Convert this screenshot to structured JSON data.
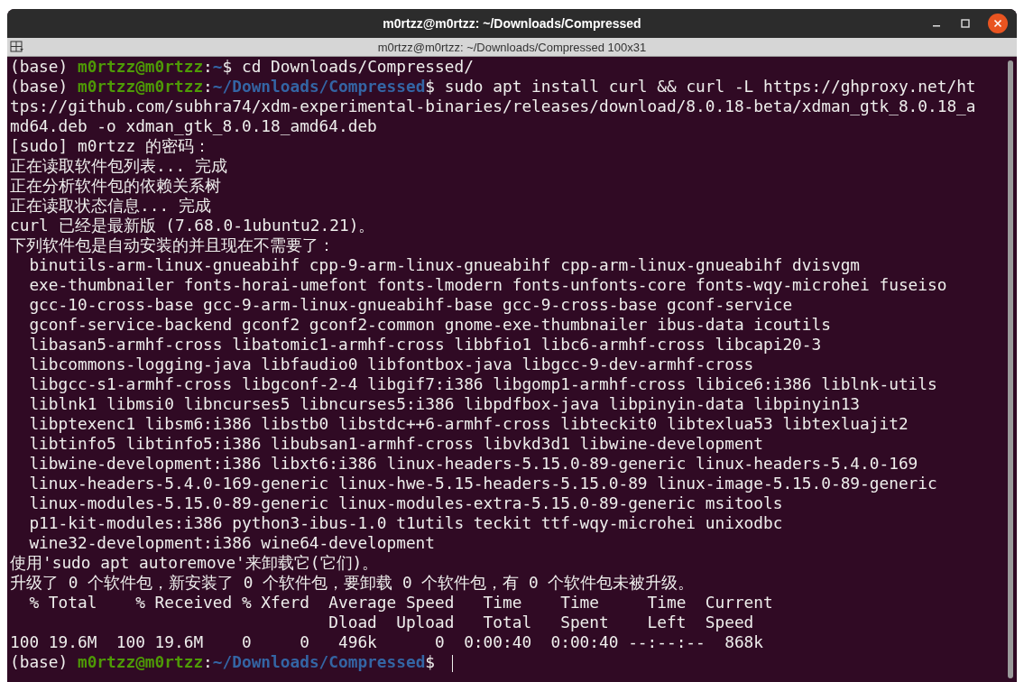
{
  "window": {
    "title": "m0rtzz@m0rtzz: ~/Downloads/Compressed"
  },
  "tab_bar": {
    "title": "m0rtzz@m0rtzz: ~/Downloads/Compressed 100x31"
  },
  "lines": [
    {
      "kind": "prompt",
      "segments": [
        {
          "kind": "plain",
          "text": "(base) "
        },
        {
          "kind": "user",
          "text": "m0rtzz@m0rtzz"
        },
        {
          "kind": "plain",
          "text": ":"
        },
        {
          "kind": "path",
          "text": "~"
        },
        {
          "kind": "plain",
          "text": "$ cd Downloads/Compressed/"
        }
      ]
    },
    {
      "kind": "prompt",
      "segments": [
        {
          "kind": "plain",
          "text": "(base) "
        },
        {
          "kind": "user",
          "text": "m0rtzz@m0rtzz"
        },
        {
          "kind": "plain",
          "text": ":"
        },
        {
          "kind": "path",
          "text": "~/Downloads/Compressed"
        },
        {
          "kind": "plain",
          "text": "$ sudo apt install curl && curl -L https://ghproxy.net/ht"
        }
      ]
    },
    {
      "kind": "text",
      "text": "tps://github.com/subhra74/xdm-experimental-binaries/releases/download/8.0.18-beta/xdman_gtk_8.0.18_a"
    },
    {
      "kind": "text",
      "text": "md64.deb -o xdman_gtk_8.0.18_amd64.deb"
    },
    {
      "kind": "text",
      "text": "[sudo] m0rtzz 的密码："
    },
    {
      "kind": "text",
      "text": "正在读取软件包列表... 完成"
    },
    {
      "kind": "text",
      "text": "正在分析软件包的依赖关系树"
    },
    {
      "kind": "text",
      "text": "正在读取状态信息... 完成"
    },
    {
      "kind": "text",
      "text": "curl 已经是最新版 (7.68.0-1ubuntu2.21)。"
    },
    {
      "kind": "text",
      "text": "下列软件包是自动安装的并且现在不需要了："
    },
    {
      "kind": "text",
      "text": "  binutils-arm-linux-gnueabihf cpp-9-arm-linux-gnueabihf cpp-arm-linux-gnueabihf dvisvgm"
    },
    {
      "kind": "text",
      "text": "  exe-thumbnailer fonts-horai-umefont fonts-lmodern fonts-unfonts-core fonts-wqy-microhei fuseiso"
    },
    {
      "kind": "text",
      "text": "  gcc-10-cross-base gcc-9-arm-linux-gnueabihf-base gcc-9-cross-base gconf-service"
    },
    {
      "kind": "text",
      "text": "  gconf-service-backend gconf2 gconf2-common gnome-exe-thumbnailer ibus-data icoutils"
    },
    {
      "kind": "text",
      "text": "  libasan5-armhf-cross libatomic1-armhf-cross libbfio1 libc6-armhf-cross libcapi20-3"
    },
    {
      "kind": "text",
      "text": "  libcommons-logging-java libfaudio0 libfontbox-java libgcc-9-dev-armhf-cross"
    },
    {
      "kind": "text",
      "text": "  libgcc-s1-armhf-cross libgconf-2-4 libgif7:i386 libgomp1-armhf-cross libice6:i386 liblnk-utils"
    },
    {
      "kind": "text",
      "text": "  liblnk1 libmsi0 libncurses5 libncurses5:i386 libpdfbox-java libpinyin-data libpinyin13"
    },
    {
      "kind": "text",
      "text": "  libptexenc1 libsm6:i386 libstb0 libstdc++6-armhf-cross libteckit0 libtexlua53 libtexluajit2"
    },
    {
      "kind": "text",
      "text": "  libtinfo5 libtinfo5:i386 libubsan1-armhf-cross libvkd3d1 libwine-development"
    },
    {
      "kind": "text",
      "text": "  libwine-development:i386 libxt6:i386 linux-headers-5.15.0-89-generic linux-headers-5.4.0-169"
    },
    {
      "kind": "text",
      "text": "  linux-headers-5.4.0-169-generic linux-hwe-5.15-headers-5.15.0-89 linux-image-5.15.0-89-generic"
    },
    {
      "kind": "text",
      "text": "  linux-modules-5.15.0-89-generic linux-modules-extra-5.15.0-89-generic msitools"
    },
    {
      "kind": "text",
      "text": "  p11-kit-modules:i386 python3-ibus-1.0 t1utils teckit ttf-wqy-microhei unixodbc"
    },
    {
      "kind": "text",
      "text": "  wine32-development:i386 wine64-development"
    },
    {
      "kind": "text",
      "text": "使用'sudo apt autoremove'来卸载它(它们)。"
    },
    {
      "kind": "text",
      "text": "升级了 0 个软件包，新安装了 0 个软件包，要卸载 0 个软件包，有 0 个软件包未被升级。"
    },
    {
      "kind": "text",
      "text": "  % Total    % Received % Xferd  Average Speed   Time    Time     Time  Current"
    },
    {
      "kind": "text",
      "text": "                                 Dload  Upload   Total   Spent    Left  Speed"
    },
    {
      "kind": "text",
      "text": "100 19.6M  100 19.6M    0     0   496k      0  0:00:40  0:00:40 --:--:--  868k"
    },
    {
      "kind": "prompt",
      "cursor": true,
      "segments": [
        {
          "kind": "plain",
          "text": "(base) "
        },
        {
          "kind": "user",
          "text": "m0rtzz@m0rtzz"
        },
        {
          "kind": "plain",
          "text": ":"
        },
        {
          "kind": "path",
          "text": "~/Downloads/Compressed"
        },
        {
          "kind": "plain",
          "text": "$ "
        }
      ]
    }
  ]
}
